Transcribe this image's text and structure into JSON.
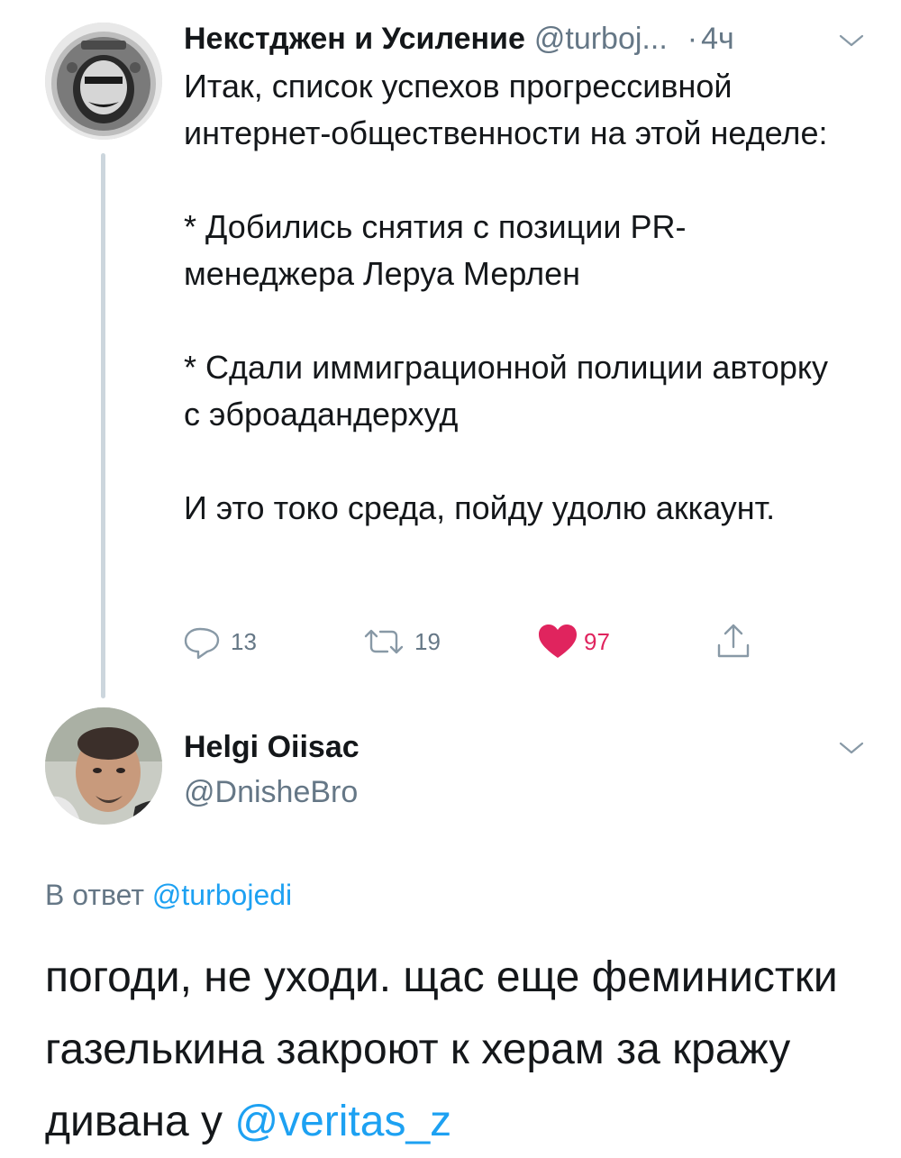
{
  "tweet": {
    "display_name": "Некстджен и Усиление",
    "handle": "@turboj...",
    "separator": "·",
    "time": "4ч",
    "paragraphs": [
      "Итак, список успехов прогрессивной интернет-общественности на этой неделе:",
      "* Добились снятия с позиции PR-менеджера Леруа Мерлен",
      "* Сдали иммиграционной полиции авторку с эброадандерхуд",
      "И это токо среда, пойду удолю аккаунт."
    ],
    "actions": {
      "reply_count": "13",
      "retweet_count": "19",
      "like_count": "97"
    }
  },
  "reply": {
    "display_name": "Helgi Oiisac",
    "handle": "@DnisheBro",
    "in_reply_prefix": "В ответ",
    "in_reply_handle": "@turbojedi",
    "text_before_mention": "погоди, не уходи. щас еще феминистки газелькина закроют к херам за кражу дивана у ",
    "mention": "@veritas_z"
  },
  "colors": {
    "link": "#1da1f2",
    "like": "#e0245e",
    "secondary": "#657786",
    "thread_line": "#ccd6dd"
  },
  "icons": {
    "reply": "comment-bubble-icon",
    "retweet": "retweet-icon",
    "like": "heart-icon",
    "share": "share-icon",
    "more": "chevron-down-icon"
  }
}
